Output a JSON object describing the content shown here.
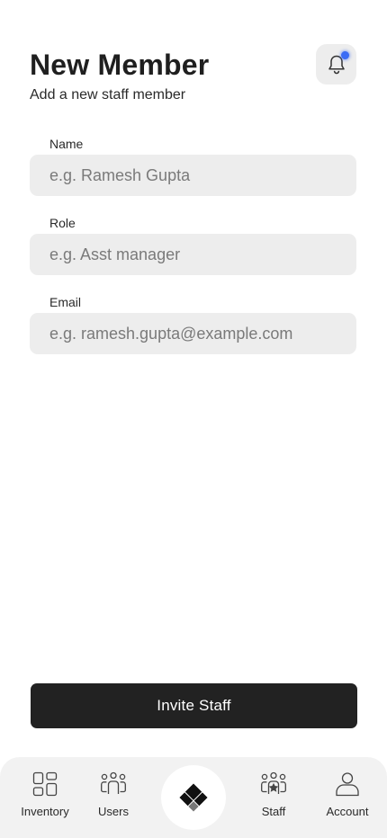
{
  "header": {
    "title": "New Member",
    "subtitle": "Add a new staff member"
  },
  "notification": {
    "icon": "bell-icon",
    "has_unread": true,
    "dot_color": "#3b6cf5"
  },
  "form": {
    "name": {
      "label": "Name",
      "placeholder": "e.g. Ramesh Gupta",
      "value": ""
    },
    "role": {
      "label": "Role",
      "placeholder": "e.g. Asst manager",
      "value": ""
    },
    "email": {
      "label": "Email",
      "placeholder": "e.g. ramesh.gupta@example.com",
      "value": ""
    },
    "submit_label": "Invite Staff"
  },
  "nav": {
    "items": [
      {
        "label": "Inventory",
        "icon": "grid-icon"
      },
      {
        "label": "Users",
        "icon": "users-icon"
      },
      {
        "label": "",
        "icon": "logo-icon"
      },
      {
        "label": "Staff",
        "icon": "staff-icon"
      },
      {
        "label": "Account",
        "icon": "person-icon"
      }
    ]
  },
  "colors": {
    "button_bg": "#222222",
    "input_bg": "#ededed",
    "nav_bg": "#f2f2f2"
  }
}
